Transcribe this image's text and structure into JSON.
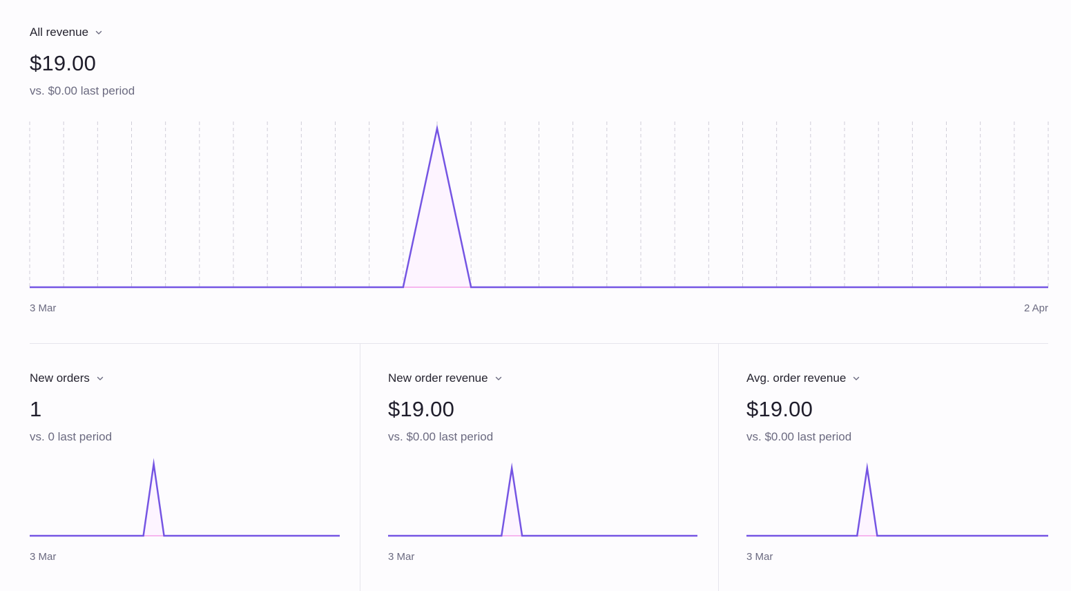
{
  "colors": {
    "line": "#7555e3",
    "fill": "#fdf4ff",
    "baseline_fill": "#f7b6ef",
    "grid": "#cfcdd8"
  },
  "main": {
    "metric_label": "All revenue",
    "value": "$19.00",
    "comparison": "vs. $0.00 last period",
    "x_start": "3 Mar",
    "x_end": "2 Apr"
  },
  "cards": [
    {
      "metric_label": "New orders",
      "value": "1",
      "comparison": "vs. 0 last period",
      "x_start": "3 Mar"
    },
    {
      "metric_label": "New order revenue",
      "value": "$19.00",
      "comparison": "vs. $0.00 last period",
      "x_start": "3 Mar"
    },
    {
      "metric_label": "Avg. order revenue",
      "value": "$19.00",
      "comparison": "vs. $0.00 last period",
      "x_start": "3 Mar"
    }
  ],
  "chart_data": [
    {
      "type": "area",
      "title": "All revenue",
      "x": [
        "3 Mar",
        "4 Mar",
        "5 Mar",
        "6 Mar",
        "7 Mar",
        "8 Mar",
        "9 Mar",
        "10 Mar",
        "11 Mar",
        "12 Mar",
        "13 Mar",
        "14 Mar",
        "15 Mar",
        "16 Mar",
        "17 Mar",
        "18 Mar",
        "19 Mar",
        "20 Mar",
        "21 Mar",
        "22 Mar",
        "23 Mar",
        "24 Mar",
        "25 Mar",
        "26 Mar",
        "27 Mar",
        "28 Mar",
        "29 Mar",
        "30 Mar",
        "31 Mar",
        "1 Apr",
        "2 Apr"
      ],
      "values": [
        0,
        0,
        0,
        0,
        0,
        0,
        0,
        0,
        0,
        0,
        0,
        0,
        19,
        0,
        0,
        0,
        0,
        0,
        0,
        0,
        0,
        0,
        0,
        0,
        0,
        0,
        0,
        0,
        0,
        0,
        0
      ],
      "ylim": [
        0,
        19
      ],
      "grid": "vertical dashed",
      "tick_labels": [
        "3 Mar",
        "2 Apr"
      ]
    },
    {
      "type": "area",
      "title": "New orders",
      "x": [
        "3 Mar",
        "4 Mar",
        "5 Mar",
        "6 Mar",
        "7 Mar",
        "8 Mar",
        "9 Mar",
        "10 Mar",
        "11 Mar",
        "12 Mar",
        "13 Mar",
        "14 Mar",
        "15 Mar",
        "16 Mar",
        "17 Mar",
        "18 Mar",
        "19 Mar",
        "20 Mar",
        "21 Mar",
        "22 Mar",
        "23 Mar",
        "24 Mar",
        "25 Mar",
        "26 Mar",
        "27 Mar",
        "28 Mar",
        "29 Mar",
        "30 Mar",
        "31 Mar",
        "1 Apr",
        "2 Apr"
      ],
      "values": [
        0,
        0,
        0,
        0,
        0,
        0,
        0,
        0,
        0,
        0,
        0,
        0,
        1,
        0,
        0,
        0,
        0,
        0,
        0,
        0,
        0,
        0,
        0,
        0,
        0,
        0,
        0,
        0,
        0,
        0,
        0
      ],
      "ylim": [
        0,
        1
      ],
      "tick_labels": [
        "3 Mar"
      ]
    },
    {
      "type": "area",
      "title": "New order revenue",
      "x": [
        "3 Mar",
        "4 Mar",
        "5 Mar",
        "6 Mar",
        "7 Mar",
        "8 Mar",
        "9 Mar",
        "10 Mar",
        "11 Mar",
        "12 Mar",
        "13 Mar",
        "14 Mar",
        "15 Mar",
        "16 Mar",
        "17 Mar",
        "18 Mar",
        "19 Mar",
        "20 Mar",
        "21 Mar",
        "22 Mar",
        "23 Mar",
        "24 Mar",
        "25 Mar",
        "26 Mar",
        "27 Mar",
        "28 Mar",
        "29 Mar",
        "30 Mar",
        "31 Mar",
        "1 Apr",
        "2 Apr"
      ],
      "values": [
        0,
        0,
        0,
        0,
        0,
        0,
        0,
        0,
        0,
        0,
        0,
        0,
        19,
        0,
        0,
        0,
        0,
        0,
        0,
        0,
        0,
        0,
        0,
        0,
        0,
        0,
        0,
        0,
        0,
        0,
        0
      ],
      "ylim": [
        0,
        19
      ],
      "tick_labels": [
        "3 Mar"
      ]
    },
    {
      "type": "area",
      "title": "Avg. order revenue",
      "x": [
        "3 Mar",
        "4 Mar",
        "5 Mar",
        "6 Mar",
        "7 Mar",
        "8 Mar",
        "9 Mar",
        "10 Mar",
        "11 Mar",
        "12 Mar",
        "13 Mar",
        "14 Mar",
        "15 Mar",
        "16 Mar",
        "17 Mar",
        "18 Mar",
        "19 Mar",
        "20 Mar",
        "21 Mar",
        "22 Mar",
        "23 Mar",
        "24 Mar",
        "25 Mar",
        "26 Mar",
        "27 Mar",
        "28 Mar",
        "29 Mar",
        "30 Mar",
        "31 Mar",
        "1 Apr",
        "2 Apr"
      ],
      "values": [
        0,
        0,
        0,
        0,
        0,
        0,
        0,
        0,
        0,
        0,
        0,
        0,
        19,
        0,
        0,
        0,
        0,
        0,
        0,
        0,
        0,
        0,
        0,
        0,
        0,
        0,
        0,
        0,
        0,
        0,
        0
      ],
      "ylim": [
        0,
        19
      ],
      "tick_labels": [
        "3 Mar"
      ]
    }
  ]
}
